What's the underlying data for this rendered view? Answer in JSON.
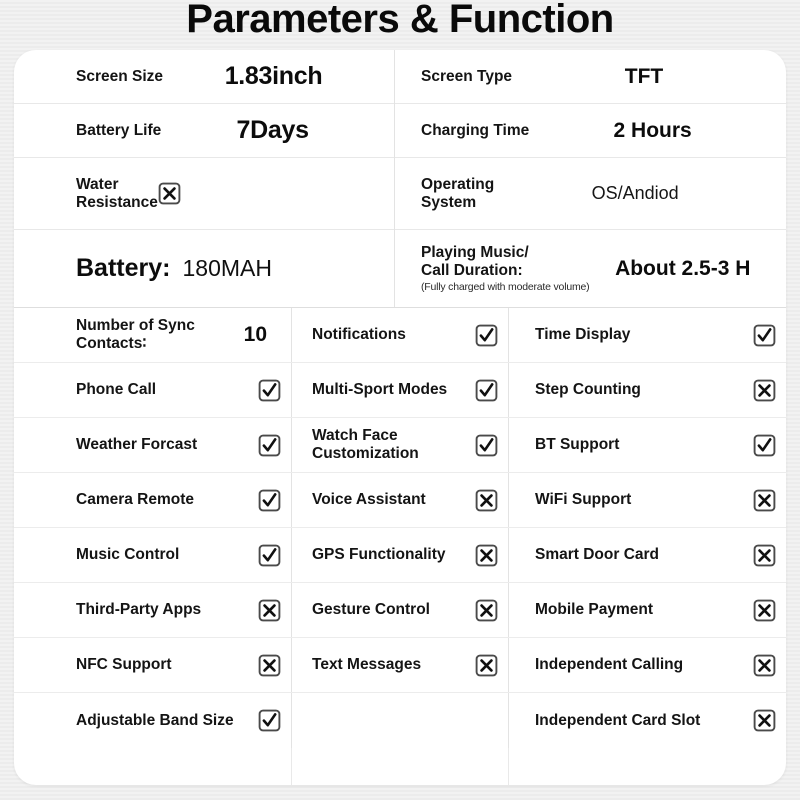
{
  "title": "Parameters & Function",
  "icons": {
    "checked": "checkbox-checked-icon",
    "unchecked": "checkbox-crossed-icon"
  },
  "specs": {
    "left": [
      {
        "key": "Screen Size",
        "value": "1.83inch",
        "style": "big"
      },
      {
        "key": "Battery Life",
        "value": "7Days",
        "style": "big"
      },
      {
        "key": "Water Resistance",
        "value": "",
        "style": "mark",
        "mark": "x"
      }
    ],
    "battery": {
      "key": "Battery:",
      "value": "180MAH"
    },
    "right": [
      {
        "key": "Screen Type",
        "value": "TFT",
        "style": "med"
      },
      {
        "key": "Charging Time",
        "value": "2 Hours",
        "style": "med"
      },
      {
        "key": "Operating System",
        "value": "OS/Andiod",
        "style": "plain"
      },
      {
        "key": "Playing Music/ Call Duration:",
        "note": "(Fully charged with moderate volume)",
        "value": "About 2.5-3 H",
        "style": "med"
      }
    ]
  },
  "features": {
    "rows": [
      [
        {
          "name": "Number of Sync Contacts∶",
          "type": "number",
          "value": "10"
        },
        {
          "name": "Notifications",
          "type": "mark",
          "value": "check"
        },
        {
          "name": "Time Display",
          "type": "mark",
          "value": "check"
        }
      ],
      [
        {
          "name": "Phone Call",
          "type": "mark",
          "value": "check"
        },
        {
          "name": "Multi-Sport Modes",
          "type": "mark",
          "value": "check"
        },
        {
          "name": "Step Counting",
          "type": "mark",
          "value": "x"
        }
      ],
      [
        {
          "name": "Weather Forcast",
          "type": "mark",
          "value": "check"
        },
        {
          "name": "Watch Face Customization",
          "type": "mark",
          "value": "check"
        },
        {
          "name": "BT Support",
          "type": "mark",
          "value": "check"
        }
      ],
      [
        {
          "name": "Camera Remote",
          "type": "mark",
          "value": "check"
        },
        {
          "name": "Voice Assistant",
          "type": "mark",
          "value": "x"
        },
        {
          "name": "WiFi Support",
          "type": "mark",
          "value": "x"
        }
      ],
      [
        {
          "name": "Music Control",
          "type": "mark",
          "value": "check"
        },
        {
          "name": "GPS Functionality",
          "type": "mark",
          "value": "x"
        },
        {
          "name": "Smart Door Card",
          "type": "mark",
          "value": "x"
        }
      ],
      [
        {
          "name": "Third-Party Apps",
          "type": "mark",
          "value": "x"
        },
        {
          "name": "Gesture Control",
          "type": "mark",
          "value": "x"
        },
        {
          "name": "Mobile Payment",
          "type": "mark",
          "value": "x"
        }
      ],
      [
        {
          "name": "NFC Support",
          "type": "mark",
          "value": "x"
        },
        {
          "name": "Text Messages",
          "type": "mark",
          "value": "x"
        },
        {
          "name": "Independent Calling",
          "type": "mark",
          "value": "x"
        }
      ],
      [
        {
          "name": "Adjustable Band Size",
          "type": "mark",
          "value": "check"
        },
        {
          "name": "",
          "type": "empty",
          "value": ""
        },
        {
          "name": "Independent Card Slot",
          "type": "mark",
          "value": "x"
        }
      ]
    ]
  },
  "colors": {
    "page_background": "#efefef",
    "card_background": "#ffffff",
    "text": "#111111",
    "divider": "#e8e8e8"
  }
}
